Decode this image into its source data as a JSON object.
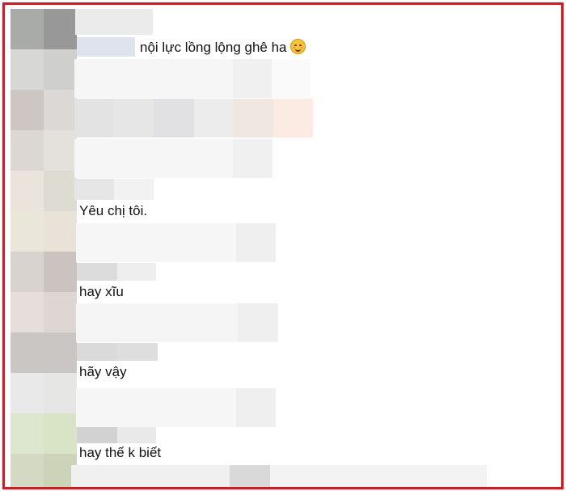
{
  "comments": [
    {
      "text": "nội lực lồng lộng ghê ha",
      "emoji": "smiling-face-with-smiling-eyes-icon"
    },
    {
      "text": "Yêu chị tôi."
    },
    {
      "text": "hay xĩu"
    },
    {
      "text": "hãy vậy"
    },
    {
      "text": "hay thế k biết"
    }
  ],
  "colors": {
    "frame_border": "#e8101a",
    "text": "#111111"
  }
}
